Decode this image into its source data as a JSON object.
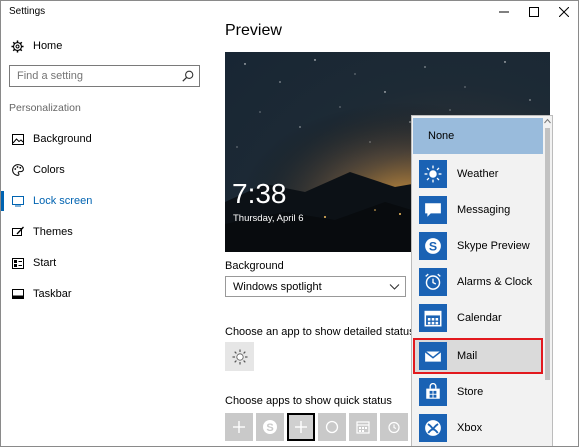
{
  "window": {
    "title": "Settings"
  },
  "sidebar": {
    "home_label": "Home",
    "search_placeholder": "Find a setting",
    "section_label": "Personalization",
    "items": [
      {
        "label": "Background",
        "icon": "image-icon"
      },
      {
        "label": "Colors",
        "icon": "palette-icon"
      },
      {
        "label": "Lock screen",
        "icon": "lock-screen-icon",
        "selected": true
      },
      {
        "label": "Themes",
        "icon": "brush-icon"
      },
      {
        "label": "Start",
        "icon": "start-icon"
      },
      {
        "label": "Taskbar",
        "icon": "taskbar-icon"
      }
    ]
  },
  "main": {
    "preview_title": "Preview",
    "preview_time": "7:38",
    "preview_date": "Thursday, April 6",
    "background_label": "Background",
    "background_value": "Windows spotlight",
    "detail_status_label": "Choose an app to show detailed status",
    "quick_status_label": "Choose apps to show quick status",
    "quick_status_icons": [
      "plus-icon",
      "skype-icon",
      "plus-icon",
      "circle-icon",
      "calendar-icon",
      "alarm-icon"
    ]
  },
  "flyout": {
    "items": [
      {
        "label": "None",
        "icon": ""
      },
      {
        "label": "Weather",
        "icon": "sun-icon"
      },
      {
        "label": "Messaging",
        "icon": "message-icon"
      },
      {
        "label": "Skype Preview",
        "icon": "skype-icon"
      },
      {
        "label": "Alarms & Clock",
        "icon": "alarm-icon"
      },
      {
        "label": "Calendar",
        "icon": "calendar-icon"
      },
      {
        "label": "Mail",
        "icon": "mail-icon",
        "highlighted": true
      },
      {
        "label": "Store",
        "icon": "store-icon"
      },
      {
        "label": "Xbox",
        "icon": "xbox-icon"
      }
    ]
  },
  "colors": {
    "accent": "#0063b1",
    "none_highlight": "#99bbdc",
    "app_tile": "#1a62b4",
    "highlight_border": "#e2191e"
  }
}
